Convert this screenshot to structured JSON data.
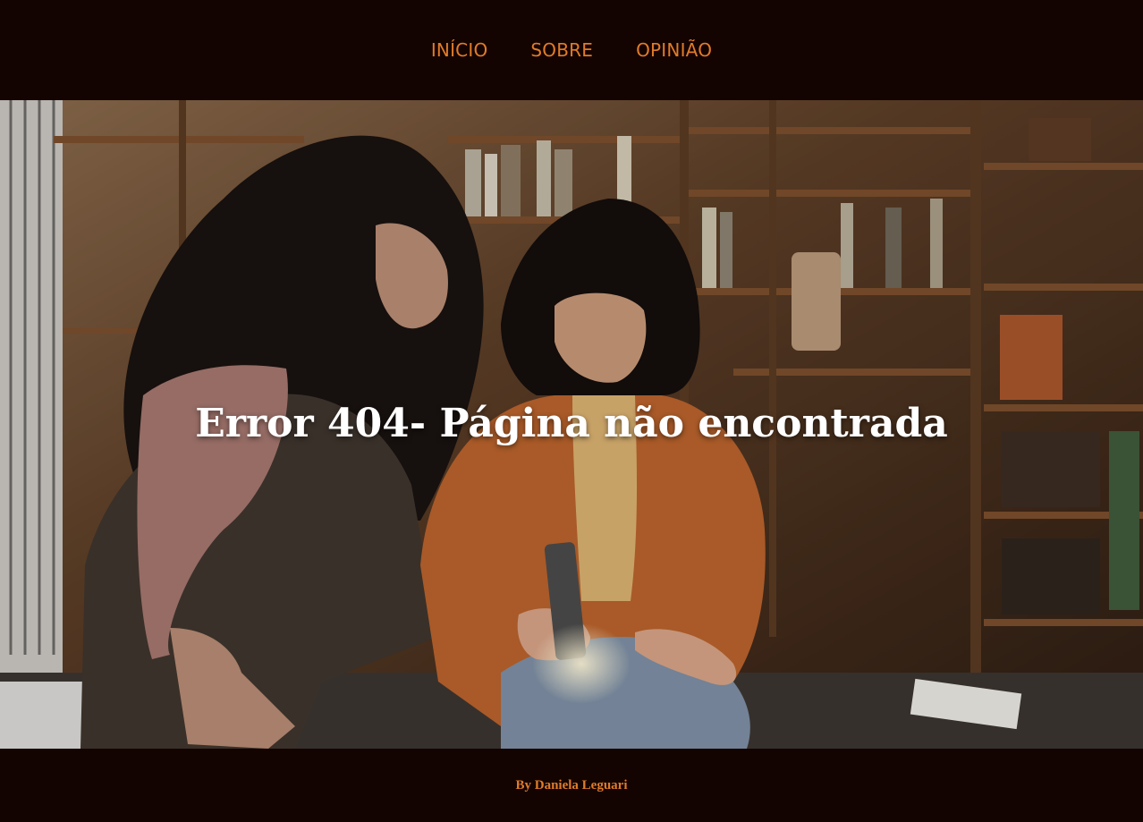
{
  "nav": {
    "items": [
      {
        "label": "INÍCIO"
      },
      {
        "label": "SOBRE"
      },
      {
        "label": "OPINIÃO"
      }
    ]
  },
  "hero": {
    "title": "Error 404- Página não encontrada",
    "image": "photo-two-people-with-flashlight-in-bookshop"
  },
  "footer": {
    "credit": "By Daniela Leguari"
  },
  "colors": {
    "background": "#140401",
    "accent": "#e07b2a",
    "title": "#ffffff"
  }
}
